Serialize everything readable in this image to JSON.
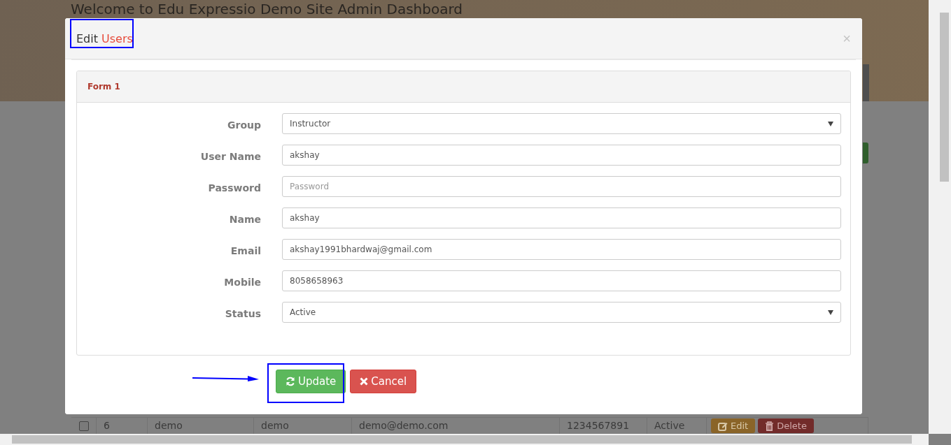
{
  "page": {
    "heading": "Welcome to Edu Expressio Demo Site Admin Dashboard",
    "table_row": {
      "checked": false,
      "cells": [
        "6",
        "demo",
        "demo",
        "demo@demo.com",
        "1234567891",
        "Active"
      ],
      "actions": [
        {
          "kind": "edit",
          "label": "Edit"
        },
        {
          "kind": "delete",
          "label": "Delete"
        }
      ]
    }
  },
  "modal": {
    "title": "Edit",
    "title_highlight": "Users",
    "close": "×",
    "panel": {
      "heading": "Form 1",
      "fields": [
        {
          "label": "Group",
          "kind": "select",
          "value": "Instructor"
        },
        {
          "label": "User Name",
          "kind": "text",
          "value": "akshay"
        },
        {
          "label": "Password",
          "kind": "text",
          "placeholder": "Password"
        },
        {
          "label": "Name",
          "kind": "text",
          "value": "akshay"
        },
        {
          "label": "Email",
          "kind": "text",
          "value": "akshay1991bhardwaj@gmail.com"
        },
        {
          "label": "Mobile",
          "kind": "text",
          "value": "8058658963"
        },
        {
          "label": "Status",
          "kind": "select",
          "value": "Active"
        }
      ]
    },
    "buttons": [
      {
        "kind": "update",
        "label": "Update"
      },
      {
        "kind": "cancel",
        "label": "Cancel"
      }
    ]
  }
}
